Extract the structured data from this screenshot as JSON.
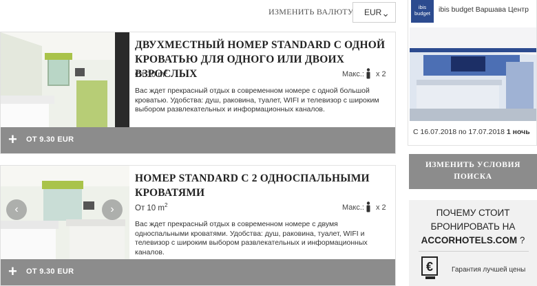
{
  "currency": {
    "label": "ИЗМЕНИТЬ ВАЛЮТУ :",
    "selected": "EUR"
  },
  "rooms": [
    {
      "title": "ДВУХМЕСТНЫЙ НОМЕР STANDARD С ОДНОЙ КРОВАТЬЮ ДЛЯ ОДНОГО ИЛИ ДВОИХ ВЗРОСЛЫХ",
      "area": "От 10 m",
      "area_unit_sup": "2",
      "max_label": "Макс.:",
      "max_count": "x 2",
      "description": "Вас ждет прекрасный отдых в современном номере с одной большой кроватью. Удобства: душ, раковина, туалет, WIFI и телевизор с широким выбором развлекательных и информационных каналов.",
      "price": "ОТ 9.30 EUR",
      "plus": "+"
    },
    {
      "title": "НОМЕР STANDARD С 2 ОДНОСПАЛЬНЫМИ КРОВАТЯМИ",
      "area": "От 10 m",
      "area_unit_sup": "2",
      "max_label": "Макс.:",
      "max_count": "x 2",
      "description": "Вас ждет прекрасный отдых в современном номере с двумя односпальными кроватями. Удобства: душ, раковина, туалет, WIFI и телевизор с широким выбором развлекательных и информационных каналов.",
      "price": "ОТ 9.30 EUR",
      "plus": "+"
    }
  ],
  "carousel": {
    "prev": "‹",
    "next": "›"
  },
  "hotel": {
    "logo_line1": "ibis",
    "logo_line2": "budget",
    "name": "ibis budget Варшава Центр",
    "dates_text": "С 16.07.2018 по 17.07.2018",
    "nights": "1 ночь"
  },
  "sidebar": {
    "modify_line1": "ИЗМЕНИТЬ УСЛОВИЯ",
    "modify_line2": "ПОИСКА",
    "why_line1": "ПОЧЕМУ СТОИТ",
    "why_line2": "БРОНИРОВАТЬ НА",
    "why_brand": "ACCORHOTELS.COM",
    "why_q": " ?",
    "guarantee": "Гарантия лучшей цены"
  },
  "icons": {
    "chevron": "chevron-down-icon",
    "person": "person-icon",
    "plus": "plus-icon",
    "euro": "euro-price-icon"
  },
  "colors": {
    "price_bar": "#8c8c8c",
    "ibis_blue": "#2c4b8f",
    "accent_green": "#a9c34a"
  }
}
